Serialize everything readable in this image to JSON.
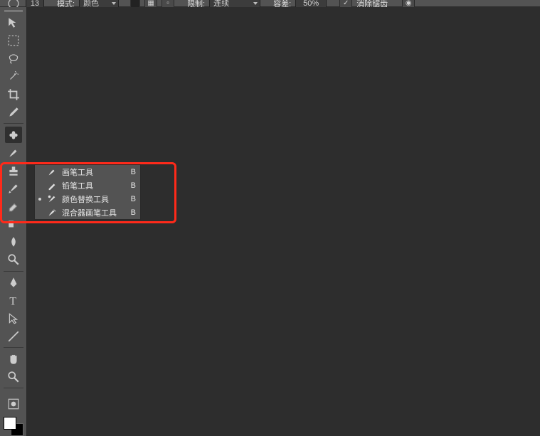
{
  "options": {
    "size_value": "13",
    "mode_label": "模式:",
    "mode_value": "颜色",
    "limit_label": "限制:",
    "limit_value": "连续",
    "tolerance_label": "容差:",
    "tolerance_value": "50%",
    "antialias_label": "消除锯齿"
  },
  "toolbox": {
    "tools": [
      "move",
      "marquee",
      "lasso",
      "wand",
      "crop",
      "eyedropper",
      "healing",
      "brush",
      "stamp",
      "history",
      "eraser",
      "gradient",
      "blur",
      "dodge",
      "pen",
      "type",
      "path-select",
      "line",
      "hand",
      "zoom"
    ]
  },
  "colors": {
    "fg": "#ffffff",
    "bg": "#000000"
  },
  "flyout": {
    "items": [
      {
        "label": "画笔工具",
        "key": "B",
        "icon": "brush",
        "active": false
      },
      {
        "label": "铅笔工具",
        "key": "B",
        "icon": "pencil",
        "active": false
      },
      {
        "label": "颜色替换工具",
        "key": "B",
        "icon": "color-replace",
        "active": true
      },
      {
        "label": "混合器画笔工具",
        "key": "B",
        "icon": "mixer-brush",
        "active": false
      }
    ]
  }
}
